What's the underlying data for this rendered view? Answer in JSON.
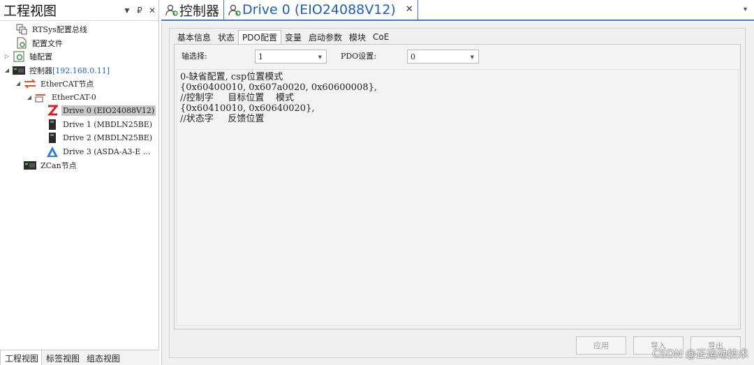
{
  "left_panel": {
    "title": "工程视图",
    "header_buttons": [
      "▼",
      "₽",
      "✕"
    ],
    "tree": [
      {
        "label": "RTSys配置总线",
        "icon": "bus-config-icon",
        "expander": ""
      },
      {
        "label": "配置文件",
        "icon": "config-file-icon",
        "expander": ""
      },
      {
        "label": "轴配置",
        "icon": "axis-config-icon",
        "expander": "▷"
      },
      {
        "label": "控制器",
        "ip": "[192.168.0.11]",
        "icon": "controller-icon",
        "expander": "◢"
      },
      {
        "label": "EtherCAT节点",
        "icon": "ethercat-icon",
        "expander": "◢"
      },
      {
        "label": "EtherCAT-0",
        "icon": "ethercat-port-icon",
        "expander": "◢"
      },
      {
        "label": "Drive 0 (EIO24088V12)",
        "icon": "zmotion-drive-icon",
        "expander": ""
      },
      {
        "label": "Drive 1 (MBDLN25BE)",
        "icon": "servo-drive-icon",
        "expander": ""
      },
      {
        "label": "Drive 2 (MBDLN25BE)",
        "icon": "servo-drive-icon",
        "expander": ""
      },
      {
        "label": "Drive 3 (ASDA-A3-E ...",
        "icon": "delta-drive-icon",
        "expander": ""
      },
      {
        "label": "ZCan节点",
        "icon": "zcan-icon",
        "expander": ""
      }
    ],
    "bottom_tabs": [
      "工程视图",
      "标签视图",
      "组态视图"
    ]
  },
  "doc_tabs": {
    "tabs": [
      {
        "label": "控制器",
        "icon": "controller-tab-icon"
      },
      {
        "label": "Drive 0 (EIO24088V12)",
        "icon": "drive-tab-icon",
        "close": "✕"
      }
    ],
    "menu": "▼"
  },
  "drive_panel": {
    "tabs": [
      "基本信息",
      "状态",
      "PDO配置",
      "变量",
      "启动参数",
      "模块",
      "CoE"
    ],
    "active_tab": "PDO配置",
    "axis_label": "轴选择:",
    "axis_value": "1",
    "pdo_label": "PDO设置:",
    "pdo_value": "0",
    "code_lines": [
      "0-缺省配置, csp位置模式",
      "{0x60400010, 0x607a0020, 0x60600008},",
      "//控制字     目标位置    模式",
      "{0x60410010, 0x60640020},",
      "//状态字     反馈位置"
    ],
    "buttons": [
      "应用",
      "导入",
      "导出"
    ]
  },
  "watermark": "CSDN @正运动技术",
  "colors": {
    "accent": "#3d7cd4",
    "selected": "#c7c7c7",
    "link": "#1a63c7"
  }
}
